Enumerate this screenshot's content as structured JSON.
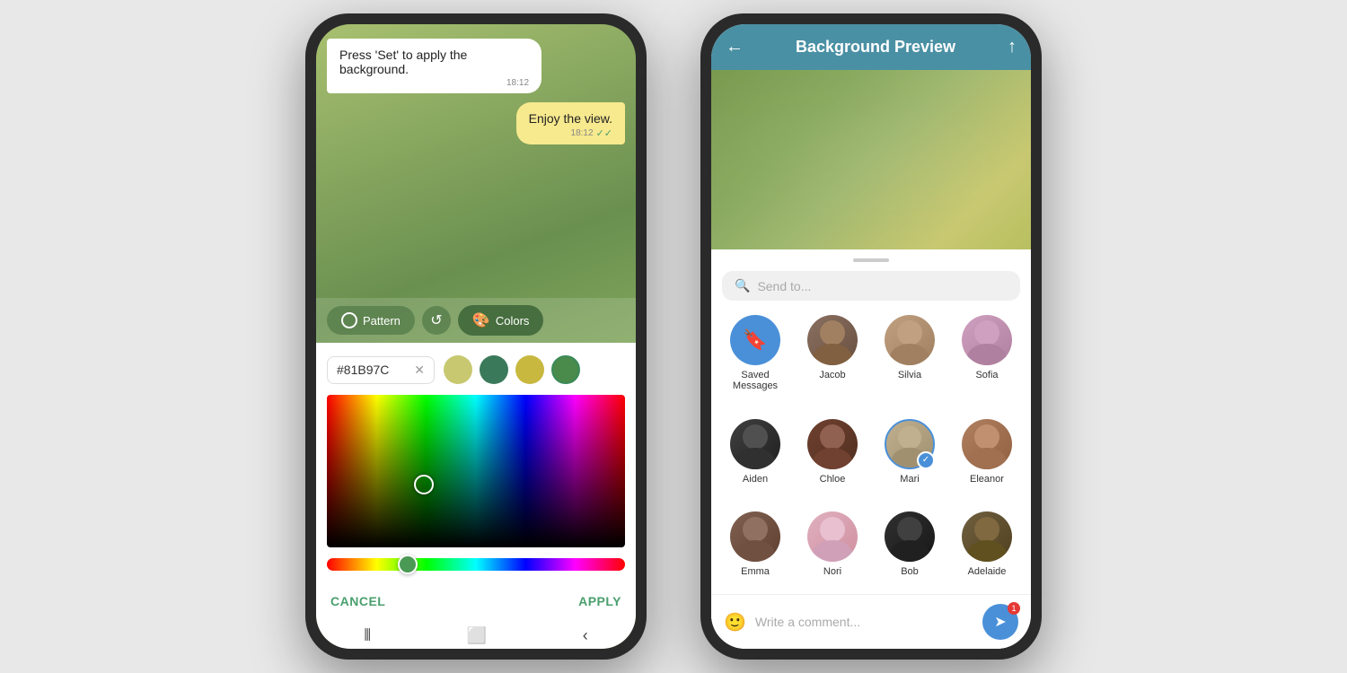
{
  "leftPhone": {
    "chat": {
      "bubbleReceived": {
        "text": "Press 'Set' to apply the background.",
        "time": "18:12"
      },
      "bubbleSent": {
        "text": "Enjoy the view.",
        "time": "18:12"
      }
    },
    "toolbar": {
      "patternLabel": "Pattern",
      "colorsLabel": "Colors"
    },
    "colorPanel": {
      "hexValue": "#81B97C",
      "presetSwatches": [
        {
          "color": "#c8c870",
          "id": "swatch1"
        },
        {
          "color": "#3a7a5a",
          "id": "swatch2"
        },
        {
          "color": "#c8b840",
          "id": "swatch3"
        },
        {
          "color": "#4a8a4a",
          "id": "swatch4",
          "outlined": true
        }
      ],
      "cancelLabel": "CANCEL",
      "applyLabel": "APPLY"
    }
  },
  "rightPhone": {
    "header": {
      "title": "Background Preview",
      "backIcon": "←",
      "shareIcon": "↑"
    },
    "search": {
      "placeholder": "Send to..."
    },
    "contacts": [
      {
        "id": "saved",
        "name": "Saved Messages",
        "type": "bookmark"
      },
      {
        "id": "jacob",
        "name": "Jacob",
        "avatarClass": "av-jacob"
      },
      {
        "id": "silvia",
        "name": "Silvia",
        "avatarClass": "av-silvia"
      },
      {
        "id": "sofia",
        "name": "Sofia",
        "avatarClass": "av-sofia"
      },
      {
        "id": "aiden",
        "name": "Aiden",
        "avatarClass": "av-aiden"
      },
      {
        "id": "chloe",
        "name": "Chloe",
        "avatarClass": "av-chloe"
      },
      {
        "id": "mari",
        "name": "Mari",
        "avatarClass": "av-mari",
        "checked": true
      },
      {
        "id": "eleanor",
        "name": "Eleanor",
        "avatarClass": "av-eleanor"
      },
      {
        "id": "emma",
        "name": "Emma",
        "avatarClass": "av-emma"
      },
      {
        "id": "nori",
        "name": "Nori",
        "avatarClass": "av-nori"
      },
      {
        "id": "bob",
        "name": "Bob",
        "avatarClass": "av-bob"
      },
      {
        "id": "adelaide",
        "name": "Adelaide",
        "avatarClass": "av-adelaide"
      }
    ],
    "commentBar": {
      "placeholder": "Write a comment...",
      "badgeCount": "1"
    }
  }
}
